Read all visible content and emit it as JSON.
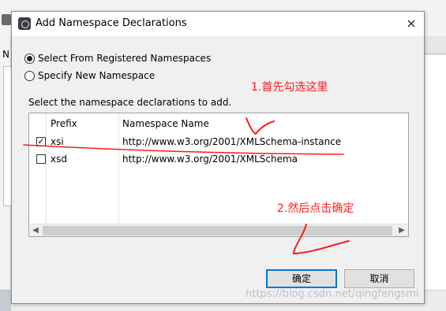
{
  "background": {
    "n_label": "N"
  },
  "dialog": {
    "title": "Add Namespace Declarations",
    "close_glyph": "×"
  },
  "options": [
    {
      "label": "Select From Registered Namespaces",
      "selected": true
    },
    {
      "label": "Specify New Namespace",
      "selected": false
    }
  ],
  "instruction": "Select the namespace declarations to add.",
  "table": {
    "columns": [
      "Prefix",
      "Namespace Name"
    ],
    "rows": [
      {
        "prefix": "xsi",
        "namespace": "http://www.w3.org/2001/XMLSchema-instance",
        "checked": true,
        "check_glyph": "✓"
      },
      {
        "prefix": "xsd",
        "namespace": "http://www.w3.org/2001/XMLSchema",
        "checked": false,
        "check_glyph": ""
      }
    ],
    "scroll_left": "◀",
    "scroll_right": "▶"
  },
  "buttons": {
    "ok": "确定",
    "cancel": "取消"
  },
  "annotations": {
    "step1": "1.首先勾选这里",
    "step2": "2.然后点击确定",
    "color": "#ff1a1a"
  },
  "watermark": "https://blog.csdn.net/qingfengsmi"
}
